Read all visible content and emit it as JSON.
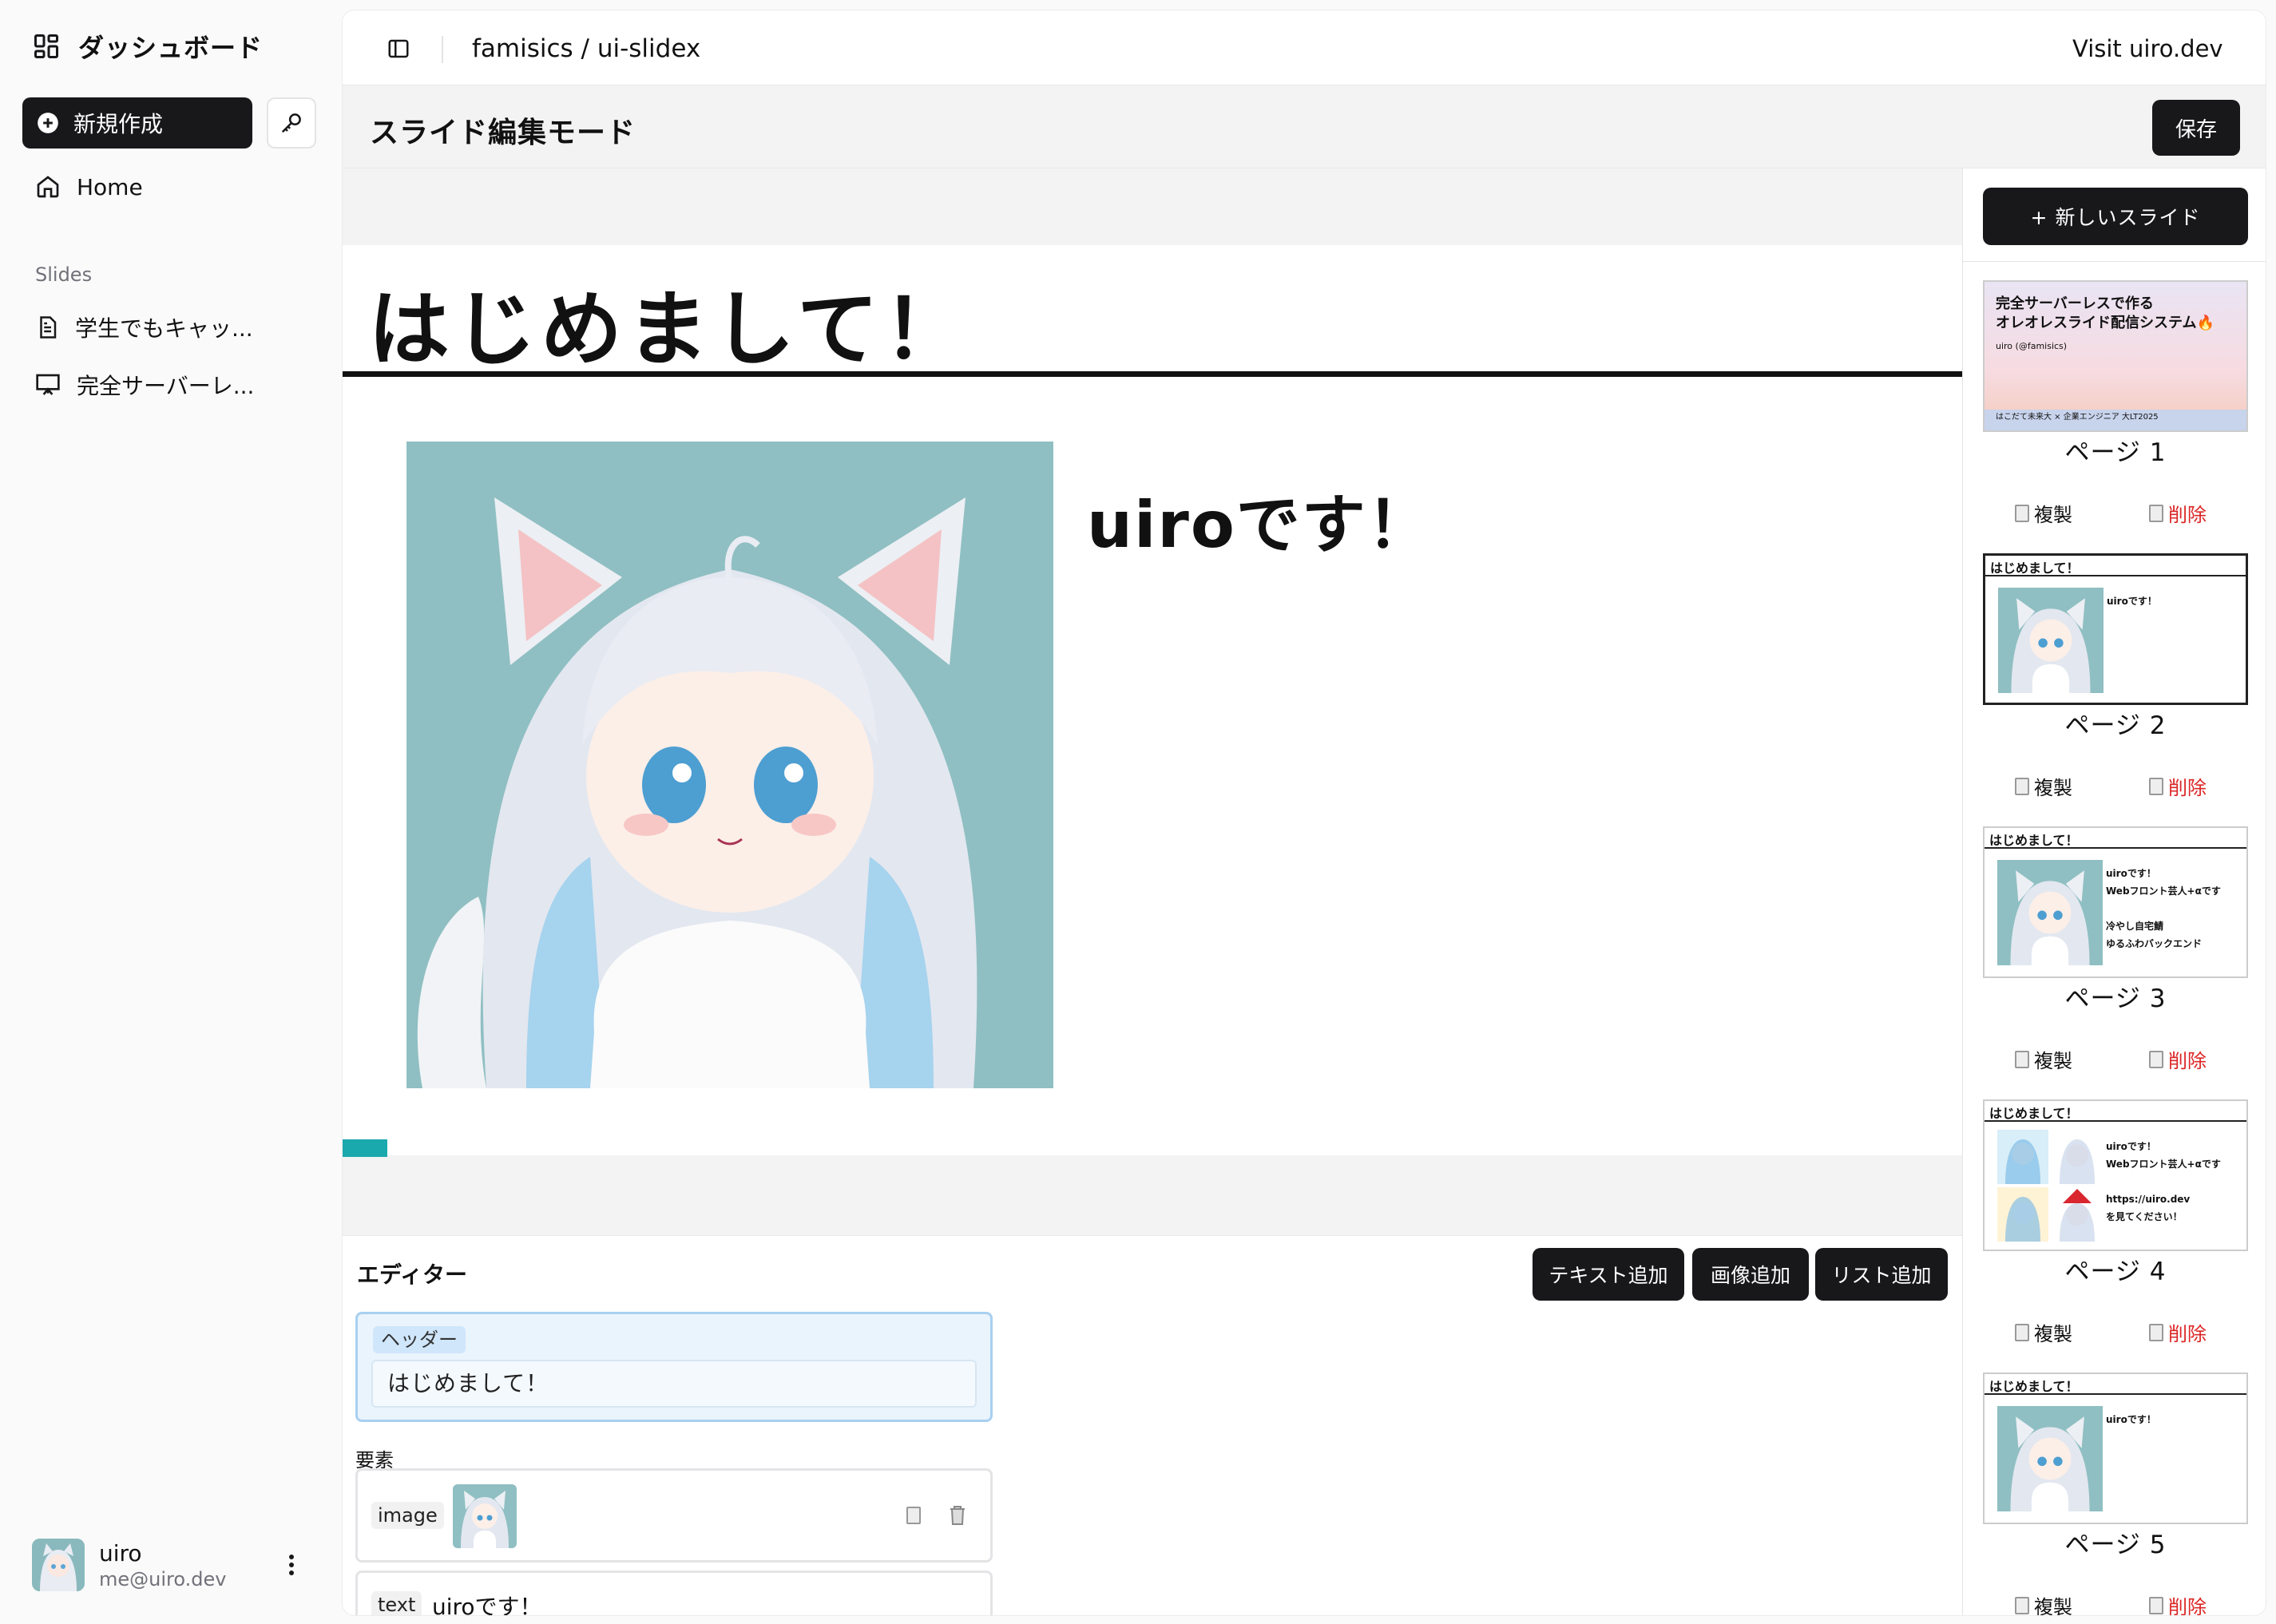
{
  "sidebar": {
    "brand": "ダッシュボード",
    "new_button": "新規作成",
    "home": "Home",
    "slides_heading": "Slides",
    "slides": [
      "学生でもキャッ...",
      "完全サーバーレ..."
    ],
    "user": {
      "name": "uiro",
      "email": "me@uiro.dev"
    }
  },
  "topbar": {
    "repo": "famisics / ui-slidex",
    "visit": "Visit uiro.dev"
  },
  "modebar": {
    "title": "スライド編集モード",
    "save": "保存"
  },
  "slide": {
    "header": "はじめまして！",
    "text": "uiroです！"
  },
  "editor": {
    "title": "エディター",
    "buttons": {
      "add_text": "テキスト追加",
      "add_image": "画像追加",
      "add_list": "リスト追加"
    },
    "header_tag": "ヘッダー",
    "header_value": "はじめまして！",
    "elements_label": "要素",
    "elements": [
      {
        "type": "image"
      },
      {
        "type": "text",
        "value": "uiroです！"
      }
    ]
  },
  "thumbnails": {
    "new_slide": "+ 新しいスライド",
    "copy": "複製",
    "delete": "削除",
    "pages": [
      {
        "label": "ページ 1",
        "title": "完全サーバーレスで作る",
        "title2": "オレオレスライド配信システム🔥",
        "byline": "uiro (@famisics)",
        "footer": "はこだて未来大 × 企業エンジニア 大LT2025"
      },
      {
        "label": "ページ 2",
        "header": "はじめまして！",
        "lines": [
          "uiroです！"
        ]
      },
      {
        "label": "ページ 3",
        "header": "はじめまして！",
        "lines": [
          "uiroです！",
          "Webフロント芸人+αです",
          "",
          "冷やし自宅鯖",
          "ゆるふわバックエンド"
        ]
      },
      {
        "label": "ページ 4",
        "header": "はじめまして！",
        "lines": [
          "uiroです！",
          "Webフロント芸人+αです",
          "",
          "https://uiro.dev",
          "を見てください！"
        ]
      },
      {
        "label": "ページ 5",
        "header": "はじめまして！",
        "lines": [
          "uiroです！"
        ]
      }
    ]
  },
  "colors": {
    "accent": "#1aa9ad",
    "dark": "#18181b",
    "danger": "#dc2626",
    "selected_border": "#a8d0f0"
  }
}
